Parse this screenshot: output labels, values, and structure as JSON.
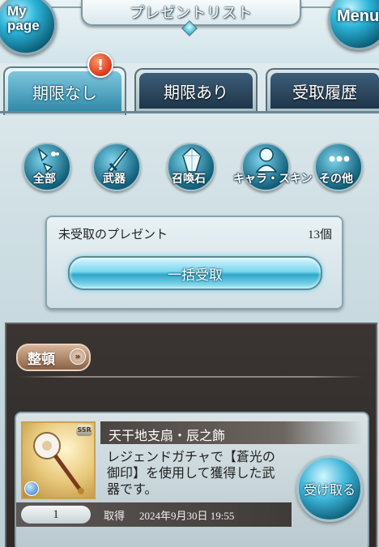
{
  "header": {
    "title": "プレゼントリスト",
    "mypage_label_1": "My",
    "mypage_label_2": "page",
    "menu_label": "Menu"
  },
  "tabs": [
    {
      "label": "期限なし",
      "active": true
    },
    {
      "label": "期限あり",
      "active": false
    },
    {
      "label": "受取履歴",
      "active": false
    }
  ],
  "notice_badge": "!",
  "filters": [
    {
      "label": "全部",
      "icon": "all-icon"
    },
    {
      "label": "武器",
      "icon": "sword-icon"
    },
    {
      "label": "召喚石",
      "icon": "crystal-icon"
    },
    {
      "label": "キャラ・スキン",
      "icon": "character-icon"
    },
    {
      "label": "その他",
      "icon": "more-icon"
    }
  ],
  "unreceived": {
    "label": "未受取のプレゼント",
    "count": "13個",
    "receive_all_label": "一括受取"
  },
  "sort": {
    "label": "整頓",
    "chevron": "»"
  },
  "item": {
    "rarity": "SSR",
    "name": "天干地支扇・辰之飾",
    "description": "レジェンドガチャで【蒼光の御印】を使用して獲得した武器です。",
    "receive_label": "受け取る",
    "quantity": "1",
    "acquired_label": "取得",
    "acquired_date": "2024年9月30日 19:55"
  },
  "colors": {
    "accent_blue": "#2ea6c9",
    "tab_inactive": "#1e3549",
    "badge_red": "#d9361b",
    "list_bg": "#2d2a28"
  }
}
